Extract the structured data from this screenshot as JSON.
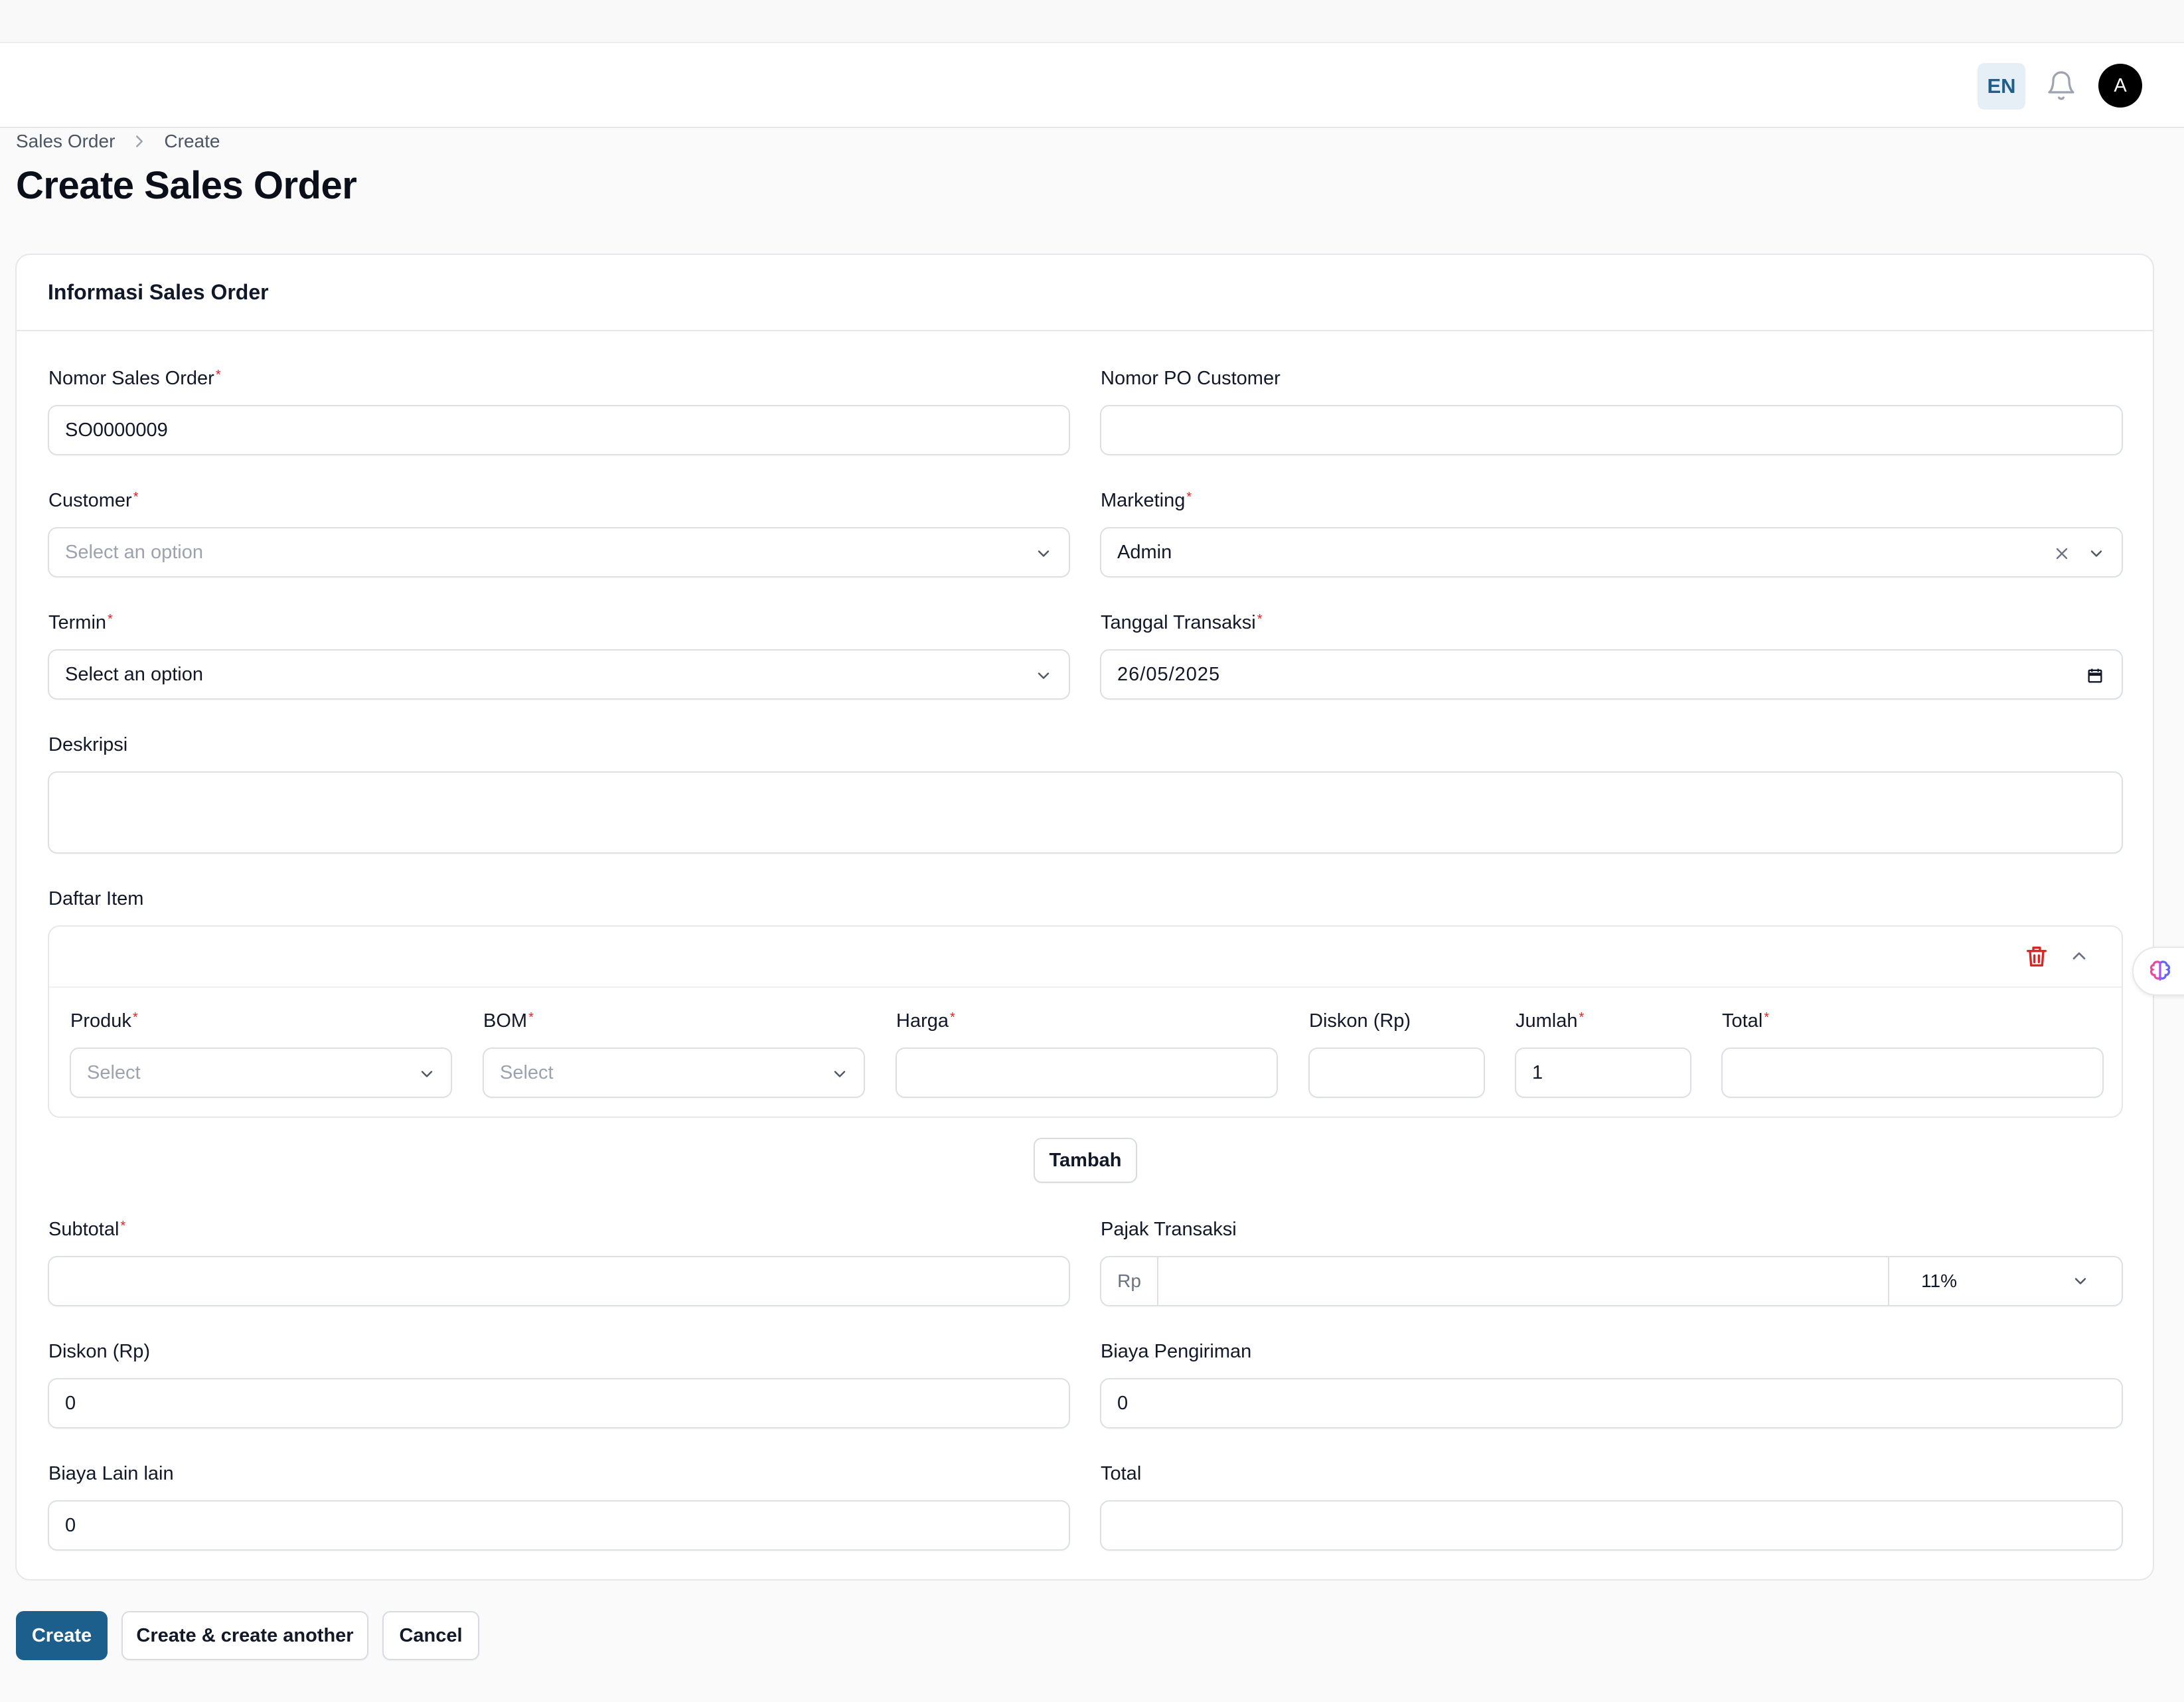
{
  "header": {
    "lang": "EN",
    "avatar_initial": "A"
  },
  "breadcrumb": [
    "Sales Order",
    "Create"
  ],
  "page_title": "Create Sales Order",
  "section_title": "Informasi Sales Order",
  "fields": {
    "nomor_so": {
      "label": "Nomor Sales Order",
      "value": "SO0000009"
    },
    "nomor_po": {
      "label": "Nomor PO Customer",
      "value": ""
    },
    "customer": {
      "label": "Customer",
      "placeholder": "Select an option"
    },
    "marketing": {
      "label": "Marketing",
      "value": "Admin"
    },
    "termin": {
      "label": "Termin",
      "value": "Select an option"
    },
    "tanggal": {
      "label": "Tanggal Transaksi",
      "value": "26/05/2025"
    },
    "deskripsi": {
      "label": "Deskripsi",
      "value": ""
    },
    "subtotal": {
      "label": "Subtotal",
      "value": ""
    },
    "pajak": {
      "label": "Pajak Transaksi",
      "prefix": "Rp",
      "value": "",
      "rate": "11%"
    },
    "diskon": {
      "label": "Diskon (Rp)",
      "value": "0"
    },
    "biaya_pengiriman": {
      "label": "Biaya Pengiriman",
      "value": "0"
    },
    "biaya_lain": {
      "label": "Biaya Lain lain",
      "value": "0"
    },
    "total": {
      "label": "Total",
      "value": ""
    }
  },
  "items": {
    "label": "Daftar Item",
    "columns": {
      "produk": {
        "label": "Produk",
        "placeholder": "Select"
      },
      "bom": {
        "label": "BOM",
        "placeholder": "Select"
      },
      "harga": {
        "label": "Harga",
        "value": ""
      },
      "diskon": {
        "label": "Diskon (Rp)",
        "value": ""
      },
      "jumlah": {
        "label": "Jumlah",
        "value": "1"
      },
      "total": {
        "label": "Total",
        "value": ""
      }
    },
    "add_label": "Tambah"
  },
  "actions": {
    "create": "Create",
    "create_another": "Create & create another",
    "cancel": "Cancel"
  },
  "colors": {
    "primary": "#1c5e8c",
    "required": "#dc2626",
    "lang_bg": "#e6eef6"
  }
}
